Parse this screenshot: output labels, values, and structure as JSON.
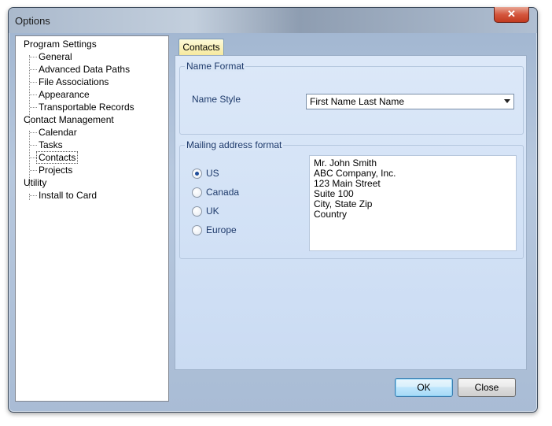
{
  "window": {
    "title": "Options"
  },
  "tree": {
    "items": [
      {
        "label": "Program Settings",
        "level": 0
      },
      {
        "label": "General",
        "level": 1
      },
      {
        "label": "Advanced Data Paths",
        "level": 1
      },
      {
        "label": "File Associations",
        "level": 1
      },
      {
        "label": "Appearance",
        "level": 1
      },
      {
        "label": "Transportable Records",
        "level": 1
      },
      {
        "label": "Contact Management",
        "level": 0
      },
      {
        "label": "Calendar",
        "level": 1
      },
      {
        "label": "Tasks",
        "level": 1
      },
      {
        "label": "Contacts",
        "level": 1,
        "selected": true
      },
      {
        "label": "Projects",
        "level": 1
      },
      {
        "label": "Utility",
        "level": 0
      },
      {
        "label": "Install to Card",
        "level": 1
      }
    ]
  },
  "tabs": [
    {
      "label": "Contacts",
      "active": true
    }
  ],
  "name_format": {
    "legend": "Name Format",
    "style_label": "Name Style",
    "style_value": "First Name Last Name"
  },
  "mailing": {
    "legend": "Mailing address format",
    "options": [
      {
        "label": "US",
        "checked": true
      },
      {
        "label": "Canada",
        "checked": false
      },
      {
        "label": "UK",
        "checked": false
      },
      {
        "label": "Europe",
        "checked": false
      }
    ],
    "preview_lines": [
      "Mr. John Smith",
      "ABC Company, Inc.",
      "123 Main Street",
      "Suite 100",
      "City, State Zip",
      "Country"
    ]
  },
  "buttons": {
    "ok": "OK",
    "close": "Close"
  },
  "icons": {
    "close": "close-icon"
  },
  "colors": {
    "accent": "#1e3a6b",
    "default_button": "#bee6fd",
    "close_button": "#c23a1f"
  }
}
